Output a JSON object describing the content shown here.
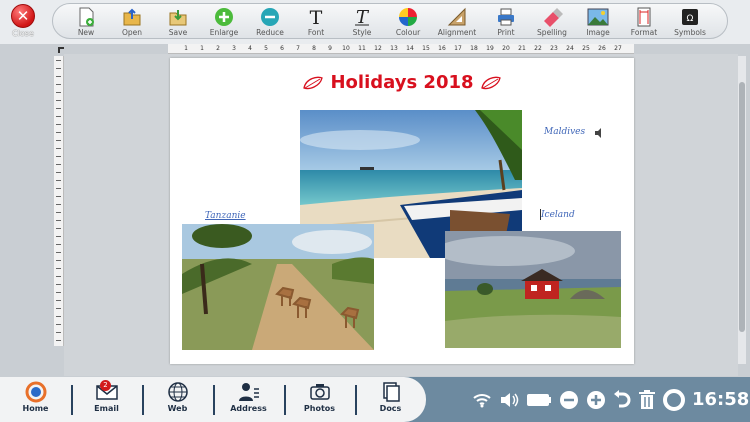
{
  "close_button": {
    "label": "Close"
  },
  "toolbar": {
    "items": [
      {
        "label": "New",
        "icon": "new-document-icon"
      },
      {
        "label": "Open",
        "icon": "open-folder-icon"
      },
      {
        "label": "Save",
        "icon": "save-icon"
      },
      {
        "label": "Enlarge",
        "icon": "plus-circle-icon"
      },
      {
        "label": "Reduce",
        "icon": "minus-circle-icon"
      },
      {
        "label": "Font",
        "icon": "font-T-icon"
      },
      {
        "label": "Style",
        "icon": "italic-T-icon"
      },
      {
        "label": "Colour",
        "icon": "color-wheel-icon"
      },
      {
        "label": "Alignment",
        "icon": "set-square-icon"
      },
      {
        "label": "Print",
        "icon": "printer-icon"
      },
      {
        "label": "Spelling",
        "icon": "eraser-pencil-icon"
      },
      {
        "label": "Image",
        "icon": "image-icon"
      },
      {
        "label": "Format",
        "icon": "page-format-icon"
      },
      {
        "label": "Symbols",
        "icon": "symbols-icon"
      }
    ]
  },
  "ruler": {
    "ticks": [
      "1",
      "1",
      "2",
      "3",
      "4",
      "5",
      "6",
      "7",
      "8",
      "9",
      "10",
      "11",
      "12",
      "13",
      "14",
      "15",
      "16",
      "17",
      "18",
      "19",
      "20",
      "21",
      "22",
      "23",
      "24",
      "25",
      "26",
      "27"
    ]
  },
  "document": {
    "title": "Holidays 2018",
    "captions": {
      "tanzania": "Tanzanie",
      "maldives": "Maldives",
      "iceland": "Iceland"
    }
  },
  "colors": {
    "title": "#d8101e",
    "caption": "#3f66b8",
    "taskbar": "#6d8aa0"
  },
  "dock": {
    "items": [
      {
        "label": "Home",
        "icon": "home-swirl-icon"
      },
      {
        "label": "Email",
        "icon": "envelope-icon",
        "badge": "2"
      },
      {
        "label": "Web",
        "icon": "globe-icon"
      },
      {
        "label": "Address",
        "icon": "address-book-icon"
      },
      {
        "label": "Photos",
        "icon": "camera-icon"
      },
      {
        "label": "Docs",
        "icon": "documents-icon"
      }
    ]
  },
  "tray": {
    "time": "16:58"
  }
}
